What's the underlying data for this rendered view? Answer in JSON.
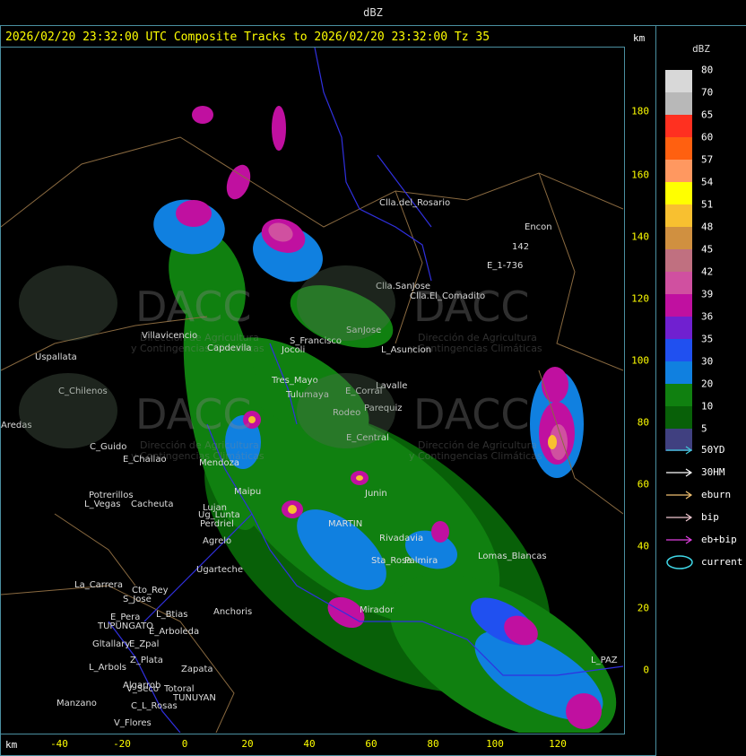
{
  "title": "dBZ",
  "header": "2026/02/20 23:32:00 UTC Composite Tracks to 2026/02/20 23:32:00 Tz 35",
  "km_label": "km",
  "legend": {
    "title": "dBZ",
    "scale": [
      {
        "value": "80",
        "color": "#d8d8d8"
      },
      {
        "value": "70",
        "color": "#b8b8b8"
      },
      {
        "value": "65",
        "color": "#ff3020"
      },
      {
        "value": "60",
        "color": "#ff6010"
      },
      {
        "value": "57",
        "color": "#ff9860"
      },
      {
        "value": "54",
        "color": "#ffff00"
      },
      {
        "value": "51",
        "color": "#f8c030"
      },
      {
        "value": "48",
        "color": "#d09040"
      },
      {
        "value": "45",
        "color": "#c07080"
      },
      {
        "value": "42",
        "color": "#d050a0"
      },
      {
        "value": "39",
        "color": "#c010a0"
      },
      {
        "value": "36",
        "color": "#7020d0"
      },
      {
        "value": "35",
        "color": "#2050f0"
      },
      {
        "value": "30",
        "color": "#1080e0"
      },
      {
        "value": "20",
        "color": "#108010"
      },
      {
        "value": "10",
        "color": "#086008"
      },
      {
        "value": "5",
        "color": "#404080"
      }
    ],
    "tracks": [
      {
        "label": "50YD",
        "color": "#40c8d8"
      },
      {
        "label": "30HM",
        "color": "#ffffff"
      },
      {
        "label": "eburn",
        "color": "#f0c070"
      },
      {
        "label": "bip",
        "color": "#f0c8d0"
      },
      {
        "label": "eb+bip",
        "color": "#e040e0"
      }
    ],
    "current_label": "current",
    "current_color": "#40d8e8"
  },
  "y_ticks": [
    "180",
    "160",
    "140",
    "120",
    "100",
    "80",
    "60",
    "40",
    "20",
    "0"
  ],
  "x_ticks": [
    "-40",
    "-20",
    "0",
    "20",
    "40",
    "60",
    "80",
    "100",
    "120"
  ],
  "map_labels": [
    "Clla.del_Rosario",
    "Encon",
    "142",
    "E_1-736",
    "Clla.SanJose",
    "Clla.El_Comadito",
    "SanJose",
    "L_Asuncion",
    "Villavicencio",
    "Capdevila",
    "S_Francisco",
    "Jocoli",
    "Uspallata",
    "Tres_Mayo",
    "Tulumaya",
    "E_Corral",
    "C_Chilenos",
    "Lavalle",
    "Rodeo",
    "Parequiz",
    "Aredas",
    "E_Central",
    "C_Guido",
    "E_Challao",
    "Mendoza",
    "Potrerillos",
    "L_Vegas",
    "Cacheuta",
    "Maipu",
    "Perdriel",
    "Agrelo",
    "MARTIN",
    "Rivadavia",
    "Junin",
    "Palmira",
    "Lomas_Blancas",
    "Ugarteche",
    "La_Carrera",
    "Cto_Rey",
    "S_Jose",
    "E_Pera",
    "L_Btias",
    "Anchoris",
    "TUPUNGATO",
    "E_Arboleda",
    "Gltallary",
    "E_Zpal",
    "L_Arbols",
    "Z_Plata",
    "Zapata",
    "Algarrob",
    "V_Seco",
    "Totoral",
    "C_L_Rosas",
    "TUNUYAN",
    "Manzano",
    "V_Flores",
    "Mirador",
    "Sta_Rosa",
    "L_PAZ",
    "Lujan",
    "Ug_Lunta"
  ],
  "watermark": {
    "text": "DACC",
    "subtitle1": "Dirección de Agricultura",
    "subtitle2": "y Contingencias Climáticas"
  }
}
